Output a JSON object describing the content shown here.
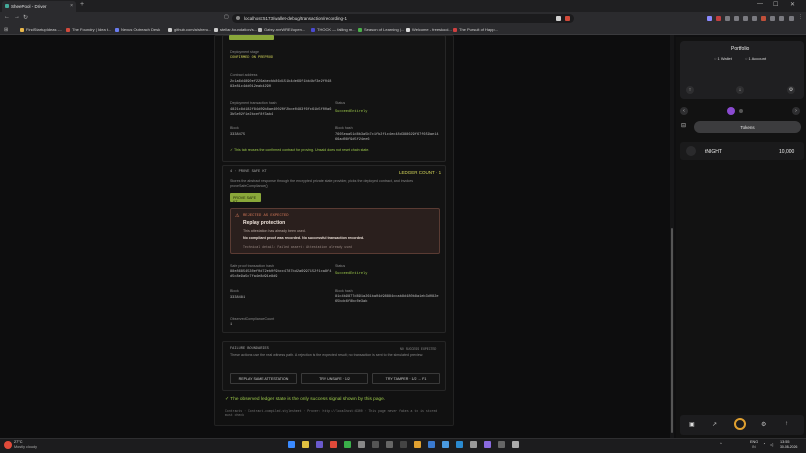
{
  "browser": {
    "tab_title": "SheePool - Driver",
    "new_tab": "+",
    "close_tab": "×",
    "url": "localhost:5173/wallet-debug/transaction/recording-1",
    "bookmarks": [
      {
        "label": "FindStartupIdeas -...",
        "color": "#e8b64a"
      },
      {
        "label": "The Foundry | Idea t...",
        "color": "#d24a3c"
      },
      {
        "label": "Nexus Outreach Desk",
        "color": "#6a7cf0"
      },
      {
        "label": "github.com/a/sheru...",
        "color": "#cccccc"
      },
      {
        "label": "stellar-foundation/s...",
        "color": "#cccccc"
      },
      {
        "label": "Gatsy-nvrWREI/open...",
        "color": "#bbbbbb"
      },
      {
        "label": "THOCK — falling m...",
        "color": "#4a4ad0"
      },
      {
        "label": "Season of Learning |...",
        "color": "#4ab04a"
      },
      {
        "label": "Welcome - freeskool...",
        "color": "#dddddd"
      },
      {
        "label": "The Pursuit of Happ...",
        "color": "#d04040"
      }
    ]
  },
  "deployment": {
    "stage_label": "Deployment stage",
    "stage_value": "CONFIRMED ON PREPROD",
    "contract_label": "Contract address",
    "contract_value": "2c1a6d4890ef226abecbb86d151b4de69f1bb4bf3e2f04883e81c4dd012eab4290",
    "tx_label": "Deployment transaction hash",
    "tx_value": "4821c8d182f84d09b8ae40020f2bce0483f6fc61b5f00a63b5e02f1e2bcef8f3ab4",
    "status_label": "Status",
    "status_value": "SucceedEntirely",
    "block_label": "Block",
    "block_value": "3338475",
    "block_hash_label": "Block hash",
    "block_hash_value": "7665eaa51d8b3a5b7c1fb2f1c4ec48d388629f67f659ae1466ad08f9d5f24ee6",
    "note": "✓ This tab reuses the confirmed contract for proving. Unsaid does not reset chain state."
  },
  "prove": {
    "step": "4 · PROVE SAFE KT",
    "counter": "LEDGER COUNT · 1",
    "description": "Stores the abstract response through the encrypted private state provider, picks the deployed contract, and invokes proveSafeCompliance()",
    "button": "PROVE SAFE KT"
  },
  "rejection": {
    "tag": "REJECTED AS EXPECTED",
    "title": "Replay protection",
    "line1": "This attestation has already been used.",
    "line2": "No compliant proof was recorded. No successful transaction recorded.",
    "tech": "Technical detail: Failed assert: Attestation already used"
  },
  "second": {
    "tx_label": "Safe proof transaction hash",
    "tx_value": "88e86854530ef0d72eb0f9bcc4787bd2a6997152f1ca8f4d5c8e9a5c7fa4e8d91e8d9",
    "status_label": "Status",
    "status_value": "SucceedEntirely",
    "block_label": "Block",
    "block_value": "3338481",
    "block_hash_label": "Block hash",
    "block_hash_value": "81c4b9877d891a261ba04d98884ccab8d480b8a1eb3d082e65bdc6f8bc0e3ab",
    "counter_label": "ObservedComplianceCount",
    "counter_value": "1"
  },
  "failure": {
    "title": "FAILURE BOUNDARIES",
    "tag": "NO SUCCESS EXPECTED",
    "description": "These actions use the real witness path. A rejection is the expected result; no transaction is sent to the simulated preview.",
    "buttons": [
      "REPLAY SAME ATTESTATION",
      "TRY UNSAFE · 1/2",
      "TRY TAMPER · 1/2 → F1"
    ]
  },
  "footer": {
    "success_note": "✓ The observed ledger state is the only success signal shown by this page.",
    "meta": "Contracts · Contract-compiled-stylesheet · Prover: http://localhost:6300 · This page never fakes a tx is stored must check"
  },
  "wallet": {
    "title": "Portfolio",
    "wallets": "1 Wallet",
    "accounts": "1 Account",
    "tokens_tab": "Tokens",
    "token_name": "tNIGHT",
    "token_amount": "10,000"
  },
  "taskbar": {
    "temp": "27°C",
    "weather": "Mostly cloudy",
    "lang": "ENG",
    "region": "IN",
    "time": "13:55",
    "date": "30-08-2026"
  }
}
